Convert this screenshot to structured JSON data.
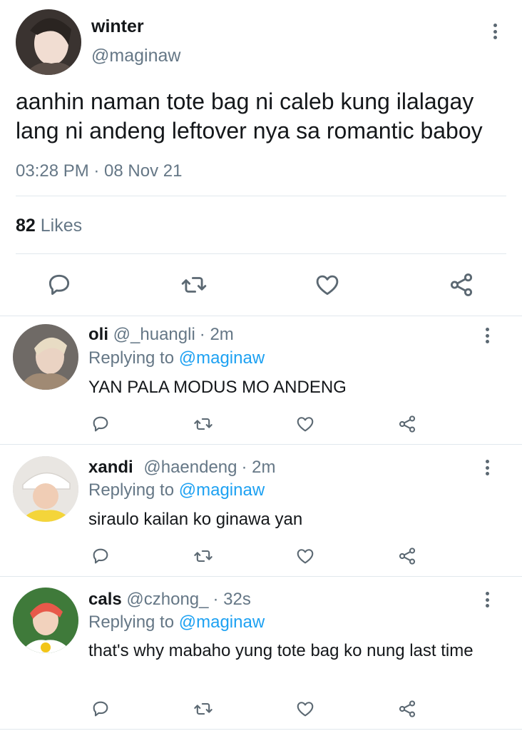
{
  "main_tweet": {
    "display_name": "winter",
    "handle": "@maginaw",
    "text": "aanhin naman tote bag ni caleb kung ilalagay lang ni andeng leftover nya sa romantic baboy",
    "timestamp": "03:28 PM · 08 Nov 21",
    "likes_count": "82",
    "likes_label": "Likes",
    "actions": [
      "reply-icon",
      "retweet-icon",
      "like-icon",
      "share-icon"
    ]
  },
  "replies": [
    {
      "display_name": "oli",
      "handle": "@_huangli",
      "time": "· 2m",
      "replying_prefix": "Replying to",
      "replying_to": "@maginaw",
      "text": "YAN PALA MODUS MO ANDENG"
    },
    {
      "display_name": "xandi",
      "handle": "@haendeng",
      "time": "· 2m",
      "replying_prefix": "Replying to",
      "replying_to": "@maginaw",
      "text": "siraulo kailan ko ginawa yan"
    },
    {
      "display_name": "cals",
      "handle": "@czhong_",
      "time": "· 32s",
      "replying_prefix": "Replying to",
      "replying_to": "@maginaw",
      "text": "that's why mabaho yung tote bag ko nung last time"
    }
  ],
  "colors": {
    "text": "#14171a",
    "muted": "#657786",
    "link": "#1da1f2",
    "divider": "#e1e8ed",
    "icon": "#5b6872"
  }
}
